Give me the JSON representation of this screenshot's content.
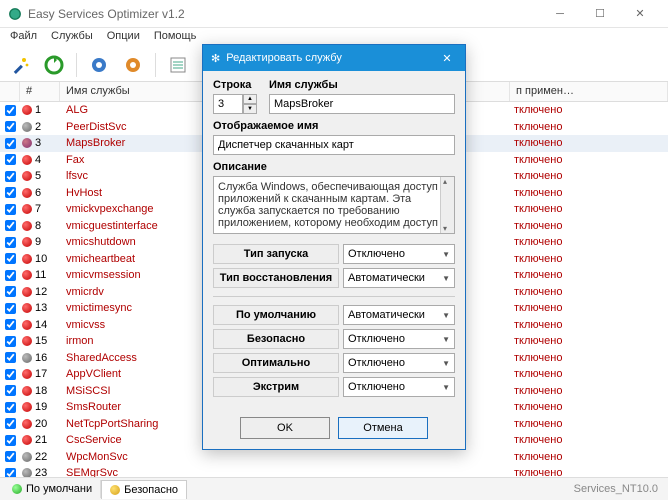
{
  "window": {
    "title": "Easy Services Optimizer v1.2"
  },
  "menu": {
    "file": "Файл",
    "services": "Службы",
    "options": "Опции",
    "help": "Помощь"
  },
  "columns": {
    "num": "#",
    "name": "Имя службы",
    "state": "п примен…"
  },
  "state_label": "тключено",
  "rows": [
    {
      "n": "1",
      "name": "ALG",
      "dot": "red"
    },
    {
      "n": "2",
      "name": "PeerDistSvc",
      "dot": "gray"
    },
    {
      "n": "3",
      "name": "MapsBroker",
      "dot": "purple",
      "selected": true
    },
    {
      "n": "4",
      "name": "Fax",
      "dot": "red"
    },
    {
      "n": "5",
      "name": "lfsvc",
      "dot": "red"
    },
    {
      "n": "6",
      "name": "HvHost",
      "dot": "red"
    },
    {
      "n": "7",
      "name": "vmickvpexchange",
      "dot": "red"
    },
    {
      "n": "8",
      "name": "vmicguestinterface",
      "dot": "red"
    },
    {
      "n": "9",
      "name": "vmicshutdown",
      "dot": "red"
    },
    {
      "n": "10",
      "name": "vmicheartbeat",
      "dot": "red"
    },
    {
      "n": "11",
      "name": "vmicvmsession",
      "dot": "red"
    },
    {
      "n": "12",
      "name": "vmicrdv",
      "dot": "red"
    },
    {
      "n": "13",
      "name": "vmictimesync",
      "dot": "red"
    },
    {
      "n": "14",
      "name": "vmicvss",
      "dot": "red"
    },
    {
      "n": "15",
      "name": "irmon",
      "dot": "red"
    },
    {
      "n": "16",
      "name": "SharedAccess",
      "dot": "gray"
    },
    {
      "n": "17",
      "name": "AppVClient",
      "dot": "red"
    },
    {
      "n": "18",
      "name": "MSiSCSI",
      "dot": "red"
    },
    {
      "n": "19",
      "name": "SmsRouter",
      "dot": "red"
    },
    {
      "n": "20",
      "name": "NetTcpPortSharing",
      "dot": "red"
    },
    {
      "n": "21",
      "name": "CscService",
      "dot": "red"
    },
    {
      "n": "22",
      "name": "WpcMonSvc",
      "dot": "gray"
    },
    {
      "n": "23",
      "name": "SEMgrSvc",
      "dot": "gray"
    }
  ],
  "tabs": {
    "default": "По умолчани",
    "safe": "Безопасно"
  },
  "status": "Services_NT10.0",
  "dialog": {
    "title": "Редактировать службу",
    "line_label": "Строка",
    "name_label": "Имя службы",
    "line_value": "3",
    "name_value": "MapsBroker",
    "display_label": "Отображаемое имя",
    "display_value": "Диспетчер скачанных карт",
    "desc_label": "Описание",
    "desc_value": "Служба Windows, обеспечивающая доступ приложений к скачанным картам. Эта служба запускается по требованию приложением, которому необходим доступ к",
    "startup_label": "Тип запуска",
    "startup_value": "Отключено",
    "restore_label": "Тип восстановления",
    "restore_value": "Автоматически",
    "default_label": "По умолчанию",
    "default_value": "Автоматически",
    "safe_label": "Безопасно",
    "safe_value": "Отключено",
    "optimal_label": "Оптимально",
    "optimal_value": "Отключено",
    "extreme_label": "Экстрим",
    "extreme_value": "Отключено",
    "ok": "OK",
    "cancel": "Отмена"
  }
}
